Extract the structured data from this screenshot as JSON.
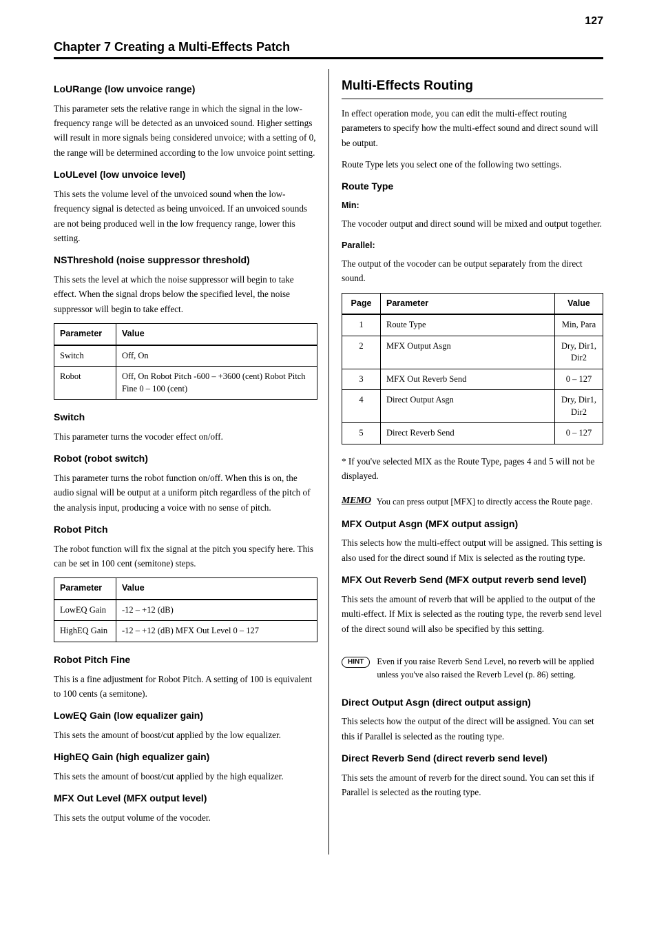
{
  "page_number": "127",
  "running_head": "Chapter 7  Creating a Multi-Effects Patch",
  "left": {
    "h3_loURange": "LoURange (low unvoice range)",
    "loURange_p": "This parameter sets the relative range in which the signal in the low-frequency range will be detected as an unvoiced sound. Higher settings will result in more signals being considered unvoice; with a setting of 0, the range will be determined according to the low unvoice point setting.",
    "h3_loULevel": "LoULevel (low unvoice level)",
    "loULevel_p": "This sets the volume level of the unvoiced sound when the low-frequency signal is detected as being unvoiced. If an unvoiced sounds are not being produced well in the low frequency range, lower this setting.",
    "h3_nsThreshold": "NSThreshold (noise suppressor threshold)",
    "nsThreshold_p": "This sets the level at which the noise suppressor will begin to take effect. When the signal drops below the specified level, the noise suppressor will begin to take effect.",
    "table1": {
      "headers": [
        "Parameter",
        "Value"
      ],
      "rows": [
        [
          "Switch",
          "Off, On"
        ],
        [
          "Robot",
          "Off, On Robot Pitch -600 – +3600 (cent) Robot Pitch Fine 0 – 100 (cent)"
        ]
      ]
    },
    "h3_switch": "Switch",
    "switch_p": "This parameter turns the vocoder effect on/off.",
    "h3_robot": "Robot (robot switch)",
    "robot_p": "This parameter turns the robot function on/off. When this is on, the audio signal will be output at a uniform pitch regardless of the pitch of the analysis input, producing a voice with no sense of pitch.",
    "h3_robotPitch": "Robot Pitch",
    "robotPitch_p": "The robot function will fix the signal at the pitch you specify here. This can be set in 100 cent (semitone) steps.",
    "table2": {
      "headers": [
        "Parameter",
        "Value"
      ],
      "rows": [
        [
          "LowEQ Gain",
          "-12 – +12 (dB)"
        ],
        [
          "HighEQ Gain",
          "-12 – +12 (dB) MFX Out Level 0 – 127"
        ]
      ]
    },
    "h3_robotPitchFine": "Robot Pitch Fine",
    "robotPitchFine_p": "This is a fine adjustment for Robot Pitch. A setting of 100 is equivalent to 100 cents (a semitone).",
    "h3_lowEQGain": "LowEQ Gain (low equalizer gain)",
    "lowEQGain_p": "This sets the amount of boost/cut applied by the low equalizer.",
    "h3_highEQGain": "HighEQ Gain (high equalizer gain)",
    "highEQGain_p": "This sets the amount of boost/cut applied by the high equalizer.",
    "h3_mfxOutLevel": "MFX Out Level (MFX output level)",
    "mfxOutLevel_p": "This sets the output volume of the vocoder."
  },
  "right": {
    "h2": "Multi-Effects Routing",
    "routing_p1": "In effect operation mode, you can edit the multi-effect routing parameters to specify how the multi-effect sound and direct sound will be output.",
    "routing_p2": "Route Type lets you select one of the following two settings.",
    "h3_routeType": "Route Type",
    "route_min": "Min:",
    "route_min_p": "The vocoder output and direct sound will be mixed and output together.",
    "route_parallel": "Parallel:",
    "route_parallel_p": "The output of the vocoder can be output separately from the direct sound.",
    "table3": {
      "headers": [
        "Page",
        "Parameter",
        "Value"
      ],
      "rows": [
        [
          "1",
          "Route Type",
          "Min, Para"
        ],
        [
          "2",
          "MFX Output Asgn",
          "Dry, Dir1, Dir2"
        ],
        [
          "3",
          "MFX Out Reverb Send",
          "0 – 127"
        ],
        [
          "4",
          "Direct Output Asgn",
          "Dry, Dir1, Dir2"
        ],
        [
          "5",
          "Direct Reverb Send",
          "0 – 127"
        ]
      ]
    },
    "aster_p": "* If you've selected MIX as the Route Type, pages 4 and 5 will not be displayed.",
    "memo_text": "You can press output [MFX] to directly access the Route page.",
    "h3_mfxOutAsgn": "MFX Output Asgn (MFX output assign)",
    "mfxOutAsgn_p": "This selects how the multi-effect output will be assigned. This setting is also used for the direct sound if Mix is selected as the routing type.",
    "h3_mfxOutReverb": "MFX Out Reverb Send (MFX output reverb send level)",
    "mfxOutReverb_p": "This sets the amount of reverb that will be applied to the output of the multi-effect. If Mix is selected as the routing type, the reverb send level of the direct sound will also be specified by this setting.",
    "hint_label": "HINT",
    "hint_text": "Even if you raise Reverb Send Level, no reverb will be applied unless you've also raised the Reverb Level (p. 86) setting.",
    "h3_directOutAsgn": "Direct Output Asgn (direct output assign)",
    "directOutAsgn_p": "This selects how the output of the direct will be assigned. You can set this if Parallel is selected as the routing type.",
    "h3_directReverb": "Direct Reverb Send (direct reverb send level)",
    "directReverb_p": "This sets the amount of reverb for the direct sound. You can set this if Parallel is selected as the routing type."
  }
}
